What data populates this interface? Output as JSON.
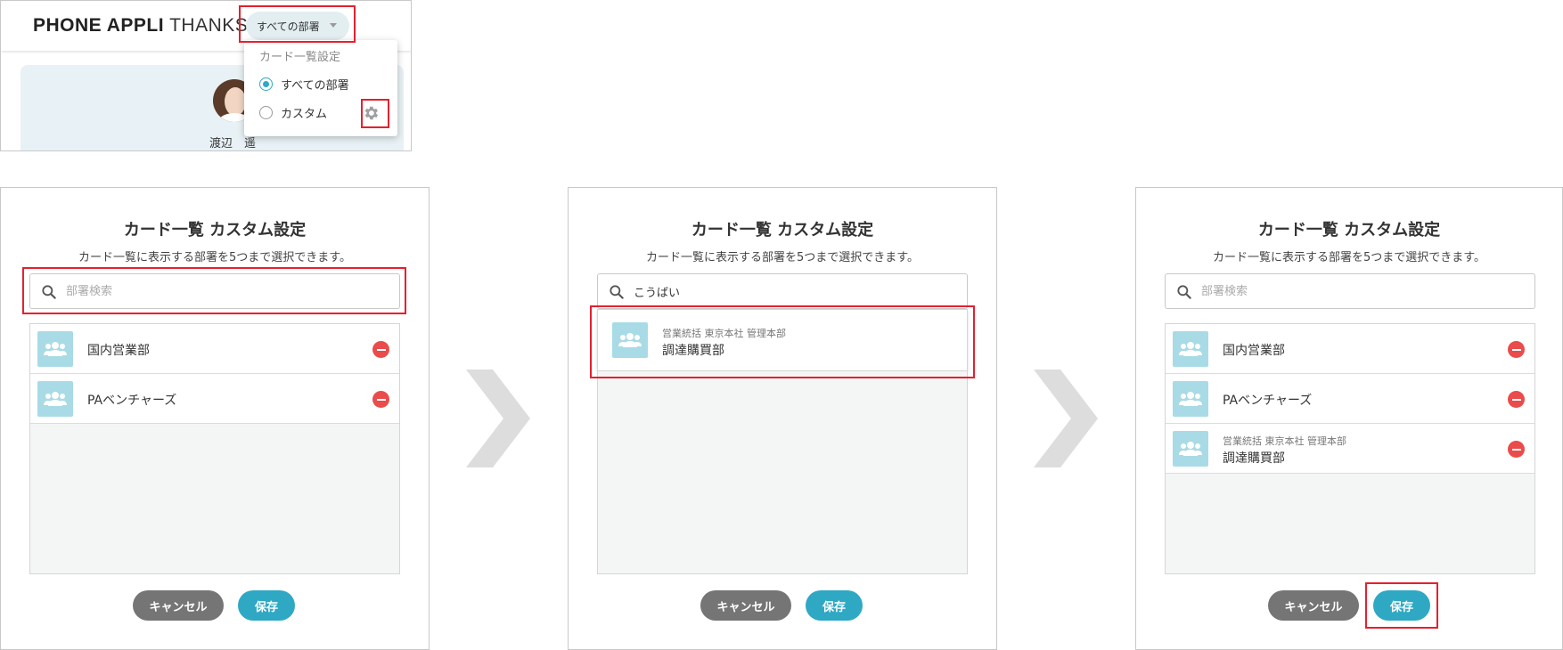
{
  "top": {
    "brand_bold": "PHONE APPLI",
    "brand_thin": "THANKS",
    "dept_select": "すべての部署",
    "user_name": "渡辺　遥",
    "dropdown": {
      "title": "カード一覧設定",
      "options": [
        {
          "label": "すべての部署",
          "selected": true
        },
        {
          "label": "カスタム",
          "selected": false
        }
      ]
    }
  },
  "panels": [
    {
      "title": "カード一覧 カスタム設定",
      "subtitle": "カード一覧に表示する部署を5つまで選択できます。",
      "search_placeholder": "部署検索",
      "search_value": "",
      "items": [
        {
          "name": "国内営業部"
        },
        {
          "name": "PAベンチャーズ"
        }
      ],
      "cancel_label": "キャンセル",
      "save_label": "保存"
    },
    {
      "title": "カード一覧 カスタム設定",
      "subtitle": "カード一覧に表示する部署を5つまで選択できます。",
      "search_placeholder": "部署検索",
      "search_value": "こうばい",
      "result": {
        "path": "営業統括 東京本社 管理本部",
        "name": "調達購買部"
      },
      "cancel_label": "キャンセル",
      "save_label": "保存"
    },
    {
      "title": "カード一覧 カスタム設定",
      "subtitle": "カード一覧に表示する部署を5つまで選択できます。",
      "search_placeholder": "部署検索",
      "search_value": "",
      "items": [
        {
          "name": "国内営業部"
        },
        {
          "name": "PAベンチャーズ"
        },
        {
          "path": "営業統括 東京本社 管理本部",
          "name": "調達購買部"
        }
      ],
      "cancel_label": "キャンセル",
      "save_label": "保存"
    }
  ],
  "colors": {
    "accent": "#2fa8c4",
    "highlight": "#e5202e",
    "remove": "#ea4b4b",
    "cancel": "#757575",
    "dept_icon_bg": "#a8dbe6"
  },
  "icons": [
    "gear-icon",
    "search-icon",
    "people-icon",
    "remove-icon",
    "chevron-right-icon",
    "caret-down-icon"
  ]
}
